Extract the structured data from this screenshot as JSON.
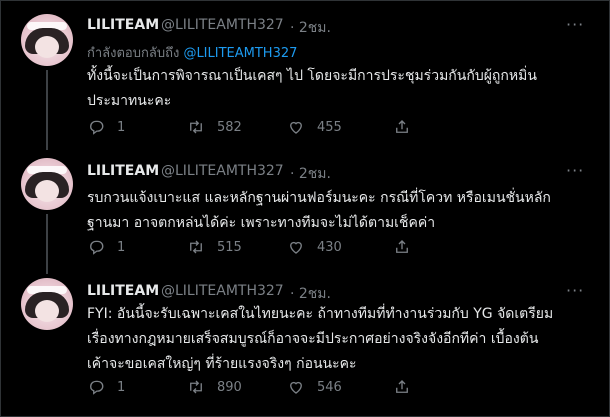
{
  "tweets": [
    {
      "name": "LILITEAM",
      "handle": "@LILITEAMTH327",
      "time": "· 2ชม.",
      "reply_prefix": "กำลังตอบกลับถึง",
      "reply_mention": "@LILITEAMTH327",
      "text_lines": [
        "ทั้งนี้จะเป็นการพิจารณาเป็นเคสๆ ไป โดยจะมีการประชุมร่วมกันกับผู้ถูกหมิ่น",
        "ประมาทนะคะ"
      ],
      "replies": "1",
      "retweets": "582",
      "likes": "455"
    },
    {
      "name": "LILITEAM",
      "handle": "@LILITEAMTH327",
      "time": "· 2ชม.",
      "text_lines": [
        "รบกวนแจ้งเบาะแส และหลักฐานผ่านฟอร์มนะคะ กรณีที่โควท หรือเมนชั่นหลัก",
        "ฐานมา อาจตกหล่นได้ค่ะ เพราะทางทีมจะไม่ได้ตามเช็คค่า"
      ],
      "replies": "1",
      "retweets": "515",
      "likes": "430"
    },
    {
      "name": "LILITEAM",
      "handle": "@LILITEAMTH327",
      "time": "· 2ชม.",
      "text_lines": [
        "FYI: อันนี้จะรับเฉพาะเคสในไทยนะคะ ถ้าทางทีมที่ทำงานร่วมกับ YG จัดเตรียม",
        "เรื่องทางกฎหมายเสร็จสมบูรณ์ก็อาจจะมีประกาศอย่างจริงจังอีกทีค่า เบื้องต้น",
        "เค้าจะขอเคสใหญ่ๆ ที่ร้ายแรงจริงๆ ก่อนนะคะ"
      ],
      "replies": "1",
      "retweets": "890",
      "likes": "546"
    }
  ],
  "icons": {
    "reply": "reply-icon",
    "retweet": "retweet-icon",
    "like": "heart-icon",
    "share": "share-icon",
    "more": "more-icon"
  },
  "colors": {
    "background": "#000000",
    "text": "#e7e9ea",
    "muted": "#7b8086",
    "mention": "#1d9bf0",
    "thread_line": "#3d4145"
  }
}
